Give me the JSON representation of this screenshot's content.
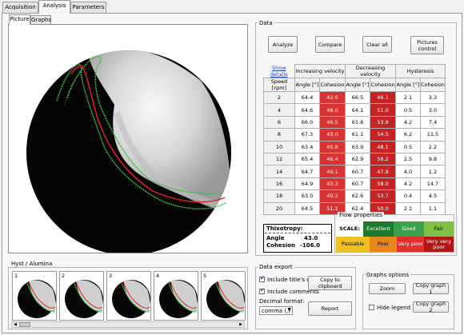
{
  "tabs": [
    "Acquisition",
    "Analysis",
    "Parameters"
  ],
  "subtabs": [
    "Picture",
    "Graphs"
  ],
  "data_group": {
    "title": "Data",
    "buttons": {
      "analyze": "Analyze",
      "compare": "Compare",
      "clear_all": "Clear all",
      "pictures_control": "Pictures control"
    },
    "show_details": "Show details",
    "groups": [
      "Increasing velocity",
      "Decreasing velocity",
      "Hysteresis"
    ],
    "col_headers": [
      "Speed [rpm]",
      "Angle [°]",
      "Cohesion",
      "Angle [°]",
      "Cohesion",
      "Angle [°]",
      "Cohesion"
    ],
    "rows": [
      [
        "2",
        "64.4",
        "42.6",
        "66.5",
        "46.1",
        "2.1",
        "3.3"
      ],
      [
        "4",
        "64.6",
        "48.0",
        "64.1",
        "51.0",
        "0.5",
        "3.0"
      ],
      [
        "6",
        "66.0",
        "46.5",
        "61.8",
        "53.9",
        "4.2",
        "7.4"
      ],
      [
        "8",
        "67.3",
        "43.0",
        "61.1",
        "54.5",
        "6.2",
        "11.5"
      ],
      [
        "10",
        "63.4",
        "45.8",
        "63.9",
        "48.1",
        "0.5",
        "2.2"
      ],
      [
        "12",
        "65.4",
        "46.4",
        "62.9",
        "56.2",
        "2.5",
        "9.8"
      ],
      [
        "14",
        "64.7",
        "49.1",
        "60.7",
        "47.9",
        "4.0",
        "1.2"
      ],
      [
        "16",
        "64.9",
        "43.3",
        "60.7",
        "58.0",
        "4.2",
        "14.7"
      ],
      [
        "18",
        "63.0",
        "49.2",
        "62.6",
        "53.7",
        "0.4",
        "4.5"
      ],
      [
        "20",
        "64.5",
        "51.1",
        "62.4",
        "50.0",
        "2.1",
        "1.1"
      ]
    ]
  },
  "thixotropy": {
    "title": "Thixotropy:",
    "angle_label": "Angle",
    "angle_value": "43.0",
    "cohesion_label": "Cohesion",
    "cohesion_value": "-106.0"
  },
  "flow_properties": {
    "title": "Flow properties",
    "scale": "SCALE:",
    "excellent": "Excellent",
    "good": "Good",
    "fair": "Fair",
    "passable": "Passable",
    "poor": "Poor",
    "very_poor": "Very poor",
    "very_very_poor": "Very very poor"
  },
  "data_export": {
    "title": "Data export",
    "include_titles": "Include title's cells",
    "include_comments": "Include comments",
    "decimal_format": "Decimal format:",
    "decimal_value": "comma (,)",
    "copy_clipboard": "Copy to clipboard",
    "report": "Report"
  },
  "graphs_options": {
    "title": "Graphs options",
    "zoom": "Zoom",
    "copy_graph1": "Copy graph 1",
    "hide_legend": "Hide legend",
    "copy_graph2": "Copy graph 2"
  },
  "thumbs": {
    "title": "Hyst / Alumina",
    "numbers": [
      "1",
      "2",
      "3",
      "4",
      "5"
    ]
  },
  "colors": {
    "cohesion_red": "#d83333",
    "excellent": "#1e7a2e",
    "good": "#3aa14a",
    "fair": "#7ec043",
    "passable": "#f0c020",
    "poor": "#e8851b",
    "very_poor": "#e03030",
    "very_very_poor": "#b01818"
  }
}
